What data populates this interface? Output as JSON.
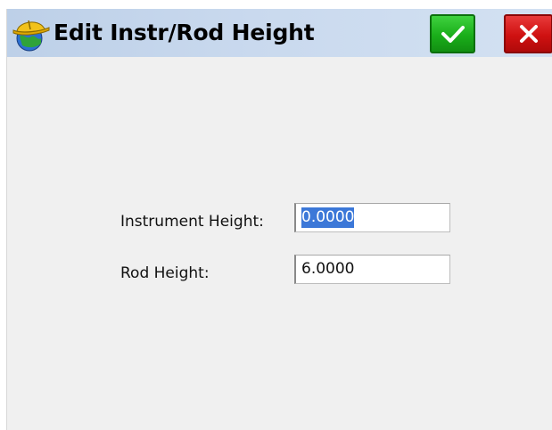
{
  "window": {
    "title": "Edit Instr/Rod Height",
    "app_icon": "surveyor-hardhat-globe-icon",
    "ok_icon": "checkmark-icon",
    "cancel_icon": "close-icon",
    "colors": {
      "titlebar": "#c9d9ee",
      "ok": "#1aae1a",
      "cancel": "#cf1111",
      "selection": "#3c78d8",
      "background": "#f0f0f0"
    }
  },
  "form": {
    "instrument_height": {
      "label": "Instrument Height:",
      "value": "0.0000",
      "selected": true
    },
    "rod_height": {
      "label": "Rod Height:",
      "value": "6.0000"
    }
  }
}
